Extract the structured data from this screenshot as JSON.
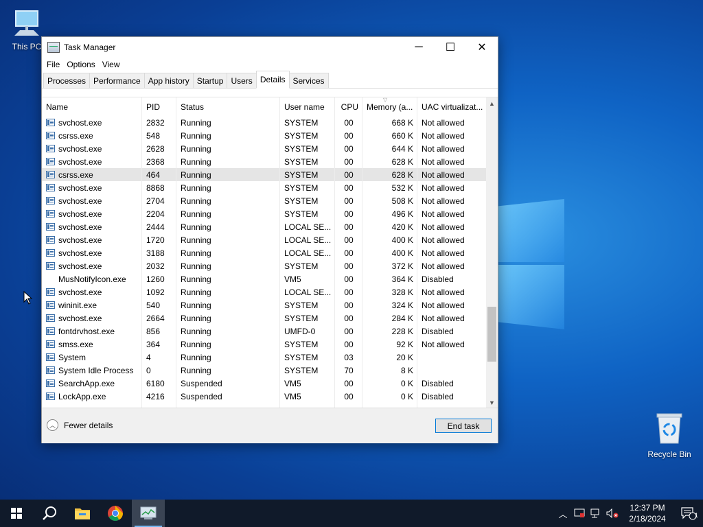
{
  "desktop": {
    "icons": [
      {
        "label": "This PC"
      },
      {
        "label": "Recycle Bin"
      }
    ]
  },
  "window": {
    "title": "Task Manager",
    "controls": {
      "minimize": "─",
      "maximize": "☐",
      "close": "✕"
    }
  },
  "menu": {
    "items": [
      "File",
      "Options",
      "View"
    ]
  },
  "tabs": {
    "items": [
      "Processes",
      "Performance",
      "App history",
      "Startup",
      "Users",
      "Details",
      "Services"
    ],
    "active": "Details"
  },
  "table": {
    "columns": [
      "Name",
      "PID",
      "Status",
      "User name",
      "CPU",
      "Memory (a...",
      "UAC virtualizat..."
    ],
    "rows": [
      {
        "name": "svchost.exe",
        "pid": "2832",
        "status": "Running",
        "user": "SYSTEM",
        "cpu": "00",
        "mem": "668 K",
        "uac": "Not allowed",
        "icon": true
      },
      {
        "name": "csrss.exe",
        "pid": "548",
        "status": "Running",
        "user": "SYSTEM",
        "cpu": "00",
        "mem": "660 K",
        "uac": "Not allowed",
        "icon": true
      },
      {
        "name": "svchost.exe",
        "pid": "2628",
        "status": "Running",
        "user": "SYSTEM",
        "cpu": "00",
        "mem": "644 K",
        "uac": "Not allowed",
        "icon": true
      },
      {
        "name": "svchost.exe",
        "pid": "2368",
        "status": "Running",
        "user": "SYSTEM",
        "cpu": "00",
        "mem": "628 K",
        "uac": "Not allowed",
        "icon": true
      },
      {
        "name": "csrss.exe",
        "pid": "464",
        "status": "Running",
        "user": "SYSTEM",
        "cpu": "00",
        "mem": "628 K",
        "uac": "Not allowed",
        "icon": true,
        "selected": true
      },
      {
        "name": "svchost.exe",
        "pid": "8868",
        "status": "Running",
        "user": "SYSTEM",
        "cpu": "00",
        "mem": "532 K",
        "uac": "Not allowed",
        "icon": true
      },
      {
        "name": "svchost.exe",
        "pid": "2704",
        "status": "Running",
        "user": "SYSTEM",
        "cpu": "00",
        "mem": "508 K",
        "uac": "Not allowed",
        "icon": true
      },
      {
        "name": "svchost.exe",
        "pid": "2204",
        "status": "Running",
        "user": "SYSTEM",
        "cpu": "00",
        "mem": "496 K",
        "uac": "Not allowed",
        "icon": true
      },
      {
        "name": "svchost.exe",
        "pid": "2444",
        "status": "Running",
        "user": "LOCAL SE...",
        "cpu": "00",
        "mem": "420 K",
        "uac": "Not allowed",
        "icon": true
      },
      {
        "name": "svchost.exe",
        "pid": "1720",
        "status": "Running",
        "user": "LOCAL SE...",
        "cpu": "00",
        "mem": "400 K",
        "uac": "Not allowed",
        "icon": true
      },
      {
        "name": "svchost.exe",
        "pid": "3188",
        "status": "Running",
        "user": "LOCAL SE...",
        "cpu": "00",
        "mem": "400 K",
        "uac": "Not allowed",
        "icon": true
      },
      {
        "name": "svchost.exe",
        "pid": "2032",
        "status": "Running",
        "user": "SYSTEM",
        "cpu": "00",
        "mem": "372 K",
        "uac": "Not allowed",
        "icon": true
      },
      {
        "name": "MusNotifyIcon.exe",
        "pid": "1260",
        "status": "Running",
        "user": "VM5",
        "cpu": "00",
        "mem": "364 K",
        "uac": "Disabled",
        "icon": false
      },
      {
        "name": "svchost.exe",
        "pid": "1092",
        "status": "Running",
        "user": "LOCAL SE...",
        "cpu": "00",
        "mem": "328 K",
        "uac": "Not allowed",
        "icon": true
      },
      {
        "name": "wininit.exe",
        "pid": "540",
        "status": "Running",
        "user": "SYSTEM",
        "cpu": "00",
        "mem": "324 K",
        "uac": "Not allowed",
        "icon": true
      },
      {
        "name": "svchost.exe",
        "pid": "2664",
        "status": "Running",
        "user": "SYSTEM",
        "cpu": "00",
        "mem": "284 K",
        "uac": "Not allowed",
        "icon": true
      },
      {
        "name": "fontdrvhost.exe",
        "pid": "856",
        "status": "Running",
        "user": "UMFD-0",
        "cpu": "00",
        "mem": "228 K",
        "uac": "Disabled",
        "icon": true
      },
      {
        "name": "smss.exe",
        "pid": "364",
        "status": "Running",
        "user": "SYSTEM",
        "cpu": "00",
        "mem": "92 K",
        "uac": "Not allowed",
        "icon": true
      },
      {
        "name": "System",
        "pid": "4",
        "status": "Running",
        "user": "SYSTEM",
        "cpu": "03",
        "mem": "20 K",
        "uac": "",
        "icon": true
      },
      {
        "name": "System Idle Process",
        "pid": "0",
        "status": "Running",
        "user": "SYSTEM",
        "cpu": "70",
        "mem": "8 K",
        "uac": "",
        "icon": true
      },
      {
        "name": "SearchApp.exe",
        "pid": "6180",
        "status": "Suspended",
        "user": "VM5",
        "cpu": "00",
        "mem": "0 K",
        "uac": "Disabled",
        "icon": true
      },
      {
        "name": "LockApp.exe",
        "pid": "4216",
        "status": "Suspended",
        "user": "VM5",
        "cpu": "00",
        "mem": "0 K",
        "uac": "Disabled",
        "icon": true
      }
    ],
    "scroll_position": 0.85
  },
  "footer": {
    "fewer_details": "Fewer details",
    "end_task": "End task"
  },
  "taskbar": {
    "items": [
      "start-icon",
      "search-icon",
      "file-explorer-icon",
      "chrome-icon",
      "task-manager-icon"
    ],
    "active": "task-manager-icon",
    "clock_time": "12:37 PM",
    "clock_date": "2/18/2024",
    "notification_count": "1"
  },
  "colors": {
    "accent": "#0078d7",
    "selection": "#e5e5e5",
    "taskbar": "#101a2a"
  }
}
